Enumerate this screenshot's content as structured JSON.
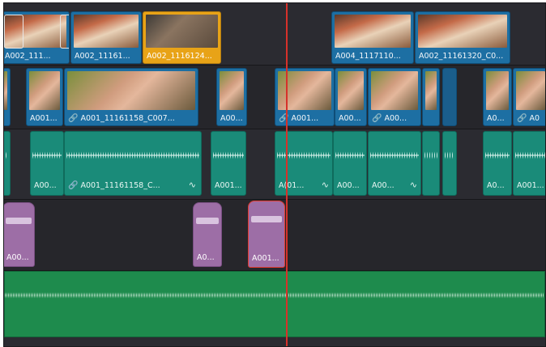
{
  "timeline": {
    "v2_clips": [
      {
        "label": "A002_111..."
      },
      {
        "label": "A002_11161..."
      },
      {
        "label": "A002_1116124..."
      },
      {
        "label": "A004_1117110..."
      },
      {
        "label": "A002_11161320_C0..."
      }
    ],
    "v1_clips": [
      {
        "label": "A001..."
      },
      {
        "label": "A001_11161158_C007..."
      },
      {
        "label": "A00..."
      },
      {
        "label": "A001..."
      },
      {
        "label": "A00..."
      },
      {
        "label": "A00..."
      },
      {
        "label": "A0..."
      },
      {
        "label": "A0"
      }
    ],
    "a1_clips": [
      {
        "label": "A00..."
      },
      {
        "label": "A001_11161158_C..."
      },
      {
        "label": "A001..."
      },
      {
        "label": "A(01..."
      },
      {
        "label": "A00..."
      },
      {
        "label": "A00..."
      },
      {
        "label": "A0..."
      },
      {
        "label": "A001..."
      }
    ],
    "a2_clips": [
      {
        "label": "A00..."
      },
      {
        "label": "A0..."
      },
      {
        "label": "A001..."
      }
    ],
    "link_icon": "link-icon",
    "fade_icon": "fade-curve-icon",
    "colors": {
      "video_clip": "#1d6fa3",
      "selected_clip": "#e8a317",
      "audio_clip": "#1a8b79",
      "purple_clip": "#9d6ea6",
      "music_clip": "#1e8b4d",
      "playhead": "#d7312a"
    }
  }
}
